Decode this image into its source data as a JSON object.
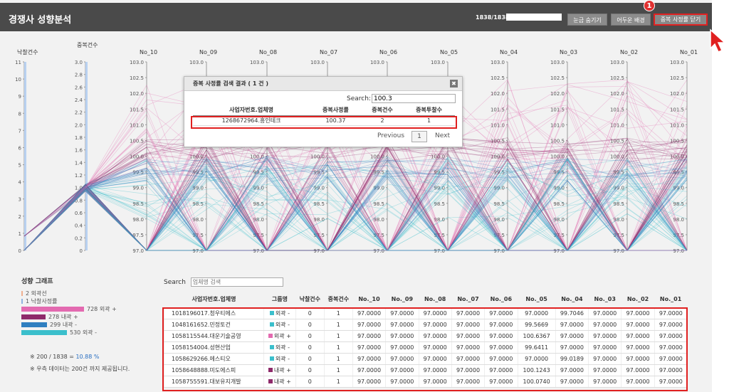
{
  "header": {
    "title": "경쟁사 성향분석",
    "counter": "1838/1838",
    "progress": 1.0,
    "buttons": [
      "눈금 숨기기",
      "어두운 배경",
      "중복 사정률 닫기"
    ],
    "badge": "1"
  },
  "chart_data": {
    "type": "parallel-coordinates",
    "axes": [
      "낙찰건수",
      "중복건수",
      "No_10",
      "No_09",
      "No_08",
      "No_07",
      "No_06",
      "No_05",
      "No_04",
      "No_03",
      "No_02",
      "No_01"
    ],
    "axis_ticks": {
      "낙찰건수": [
        "11",
        "10",
        "9",
        "8",
        "7",
        "6",
        "5",
        "4",
        "3",
        "2",
        "1",
        "0"
      ],
      "중복건수": [
        "3.0",
        "2.8",
        "2.6",
        "2.4",
        "2.2",
        "2.0",
        "1.8",
        "1.6",
        "1.4",
        "1.2",
        "1.0",
        "0.8",
        "0.6",
        "0.4",
        "0.2",
        "0"
      ],
      "No": [
        "103.0",
        "102.5",
        "102.0",
        "101.5",
        "101.0",
        "100.5",
        "100.0",
        "99.5",
        "99.0",
        "98.5",
        "98.0",
        "97.5",
        "97.0"
      ]
    },
    "series": [
      {
        "name": "외곽 +",
        "color": "#e36ab0"
      },
      {
        "name": "내곽 +",
        "color": "#8e2a6a"
      },
      {
        "name": "내곽 -",
        "color": "#2f7fc0"
      },
      {
        "name": "외곽 -",
        "color": "#3bbfcc"
      }
    ]
  },
  "modal": {
    "title": "중복 사정률 검색 결과 ( 1 건 )",
    "search_label": "Search:",
    "search_value": "100.3",
    "columns": [
      "사업자번호.업체명",
      "중복사정률",
      "중복건수",
      "중복투찰수"
    ],
    "rows": [
      [
        "1268672964.흥인테크",
        "100.37",
        "2",
        "1"
      ]
    ],
    "prev": "Previous",
    "page": "1",
    "next": "Next"
  },
  "legend": {
    "title": "성향 그래프",
    "items": [
      {
        "label": "2 외곽선",
        "color": "#f0b090",
        "bar": false
      },
      {
        "label": "1 낙찰사정률",
        "color": "#8fb3e0",
        "bar": false
      },
      {
        "label": "728 외곽 +",
        "color": "#e36ab0",
        "bar": true,
        "fraction": 1.0
      },
      {
        "label": "278 내곽 +",
        "color": "#8e2a6a",
        "bar": true,
        "fraction": 0.382
      },
      {
        "label": "299 내곽 -",
        "color": "#2f7fc0",
        "bar": true,
        "fraction": 0.411
      },
      {
        "label": "530 외곽 -",
        "color": "#3bbfcc",
        "bar": true,
        "fraction": 0.728
      }
    ],
    "stat_prefix": "※ 200 / 1838 = ",
    "stat_value": "10.88 %",
    "note": "※ 우측 데이터는 200건 까지 제공됩니다."
  },
  "table": {
    "search_label": "Search",
    "search_placeholder": "업체명 검색",
    "columns": [
      "사업자번호.업체명",
      "그룹명",
      "낙찰건수",
      "중복건수",
      "No._10",
      "No._09",
      "No._08",
      "No._07",
      "No._06",
      "No._05",
      "No._04",
      "No._03",
      "No._02",
      "No._01"
    ],
    "rows": [
      {
        "name": "1018196017.청우티에스",
        "group": "외곽 -",
        "gcolor": "#3bbfcc",
        "win": "0",
        "dup": "1",
        "vals": [
          "97.0000",
          "97.0000",
          "97.0000",
          "97.0000",
          "97.0000",
          "97.0000",
          "99.7046",
          "97.0000",
          "97.0000",
          "97.0000"
        ]
      },
      {
        "name": "1048161652.민정토건",
        "group": "외곽 -",
        "gcolor": "#3bbfcc",
        "win": "0",
        "dup": "1",
        "vals": [
          "97.0000",
          "97.0000",
          "97.0000",
          "97.0000",
          "97.0000",
          "99.5669",
          "97.0000",
          "97.0000",
          "97.0000",
          "97.0000"
        ]
      },
      {
        "name": "1058115544.대운기술공영",
        "group": "외곽 +",
        "gcolor": "#e36ab0",
        "win": "0",
        "dup": "1",
        "vals": [
          "97.0000",
          "97.0000",
          "97.0000",
          "97.0000",
          "97.0000",
          "100.6367",
          "97.0000",
          "97.0000",
          "97.0000",
          "97.0000"
        ]
      },
      {
        "name": "1058154004.성현산업",
        "group": "외곽 -",
        "gcolor": "#3bbfcc",
        "win": "0",
        "dup": "1",
        "vals": [
          "97.0000",
          "97.0000",
          "97.0000",
          "97.0000",
          "97.0000",
          "99.6411",
          "97.0000",
          "97.0000",
          "97.0000",
          "97.0000"
        ]
      },
      {
        "name": "1058629266.에스티오",
        "group": "외곽 -",
        "gcolor": "#3bbfcc",
        "win": "0",
        "dup": "1",
        "vals": [
          "97.0000",
          "97.0000",
          "97.0000",
          "97.0000",
          "97.0000",
          "97.0000",
          "99.0189",
          "97.0000",
          "97.0000",
          "97.0000"
        ]
      },
      {
        "name": "1058648888.미도에스피",
        "group": "내곽 +",
        "gcolor": "#8e2a6a",
        "win": "0",
        "dup": "1",
        "vals": [
          "97.0000",
          "97.0000",
          "97.0000",
          "97.0000",
          "97.0000",
          "100.1243",
          "97.0000",
          "97.0000",
          "97.0000",
          "97.0000"
        ]
      },
      {
        "name": "1058755591.대보유지개발",
        "group": "내곽 +",
        "gcolor": "#8e2a6a",
        "win": "0",
        "dup": "1",
        "vals": [
          "97.0000",
          "97.0000",
          "97.0000",
          "97.0000",
          "97.0000",
          "100.0740",
          "97.0000",
          "97.0000",
          "97.0000",
          "97.0000"
        ]
      }
    ]
  }
}
